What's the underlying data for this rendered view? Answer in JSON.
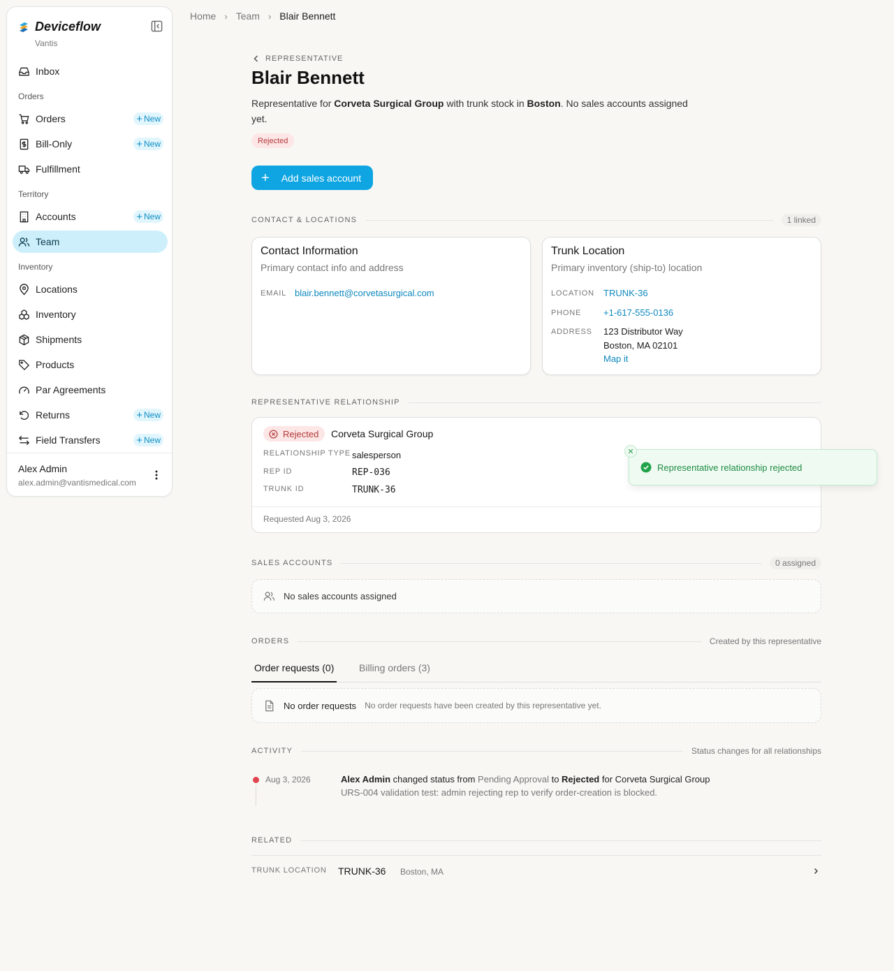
{
  "sidebar": {
    "brand": "Deviceflow",
    "org": "Vantis",
    "inbox": "Inbox",
    "sections": {
      "orders": "Orders",
      "territory": "Territory",
      "inventory": "Inventory"
    },
    "items": {
      "orders": "Orders",
      "bill_only": "Bill-Only",
      "fulfillment": "Fulfillment",
      "accounts": "Accounts",
      "team": "Team",
      "locations": "Locations",
      "inventory": "Inventory",
      "shipments": "Shipments",
      "products": "Products",
      "par_agreements": "Par Agreements",
      "returns": "Returns",
      "field_transfers": "Field Transfers"
    },
    "new_label": "New",
    "user": {
      "name": "Alex Admin",
      "email": "alex.admin@vantismedical.com"
    }
  },
  "breadcrumb": {
    "home": "Home",
    "team": "Team",
    "current": "Blair Bennett"
  },
  "header": {
    "back_label": "REPRESENTATIVE",
    "title": "Blair Bennett",
    "desc_prefix": "Representative for ",
    "desc_company": "Corveta Surgical Group",
    "desc_mid": " with trunk stock in ",
    "desc_city": "Boston",
    "desc_suffix": ". No sales accounts assigned yet.",
    "status": "Rejected",
    "add_button": "Add sales account"
  },
  "contact_section": {
    "label": "CONTACT & LOCATIONS",
    "meta": "1 linked",
    "contact_card": {
      "title": "Contact Information",
      "subtitle": "Primary contact info and address",
      "email_key": "EMAIL",
      "email": "blair.bennett@corvetasurgical.com"
    },
    "trunk_card": {
      "title": "Trunk Location",
      "subtitle": "Primary inventory (ship-to) location",
      "location_key": "LOCATION",
      "location": "TRUNK-36",
      "phone_key": "PHONE",
      "phone": "+1-617-555-0136",
      "address_key": "ADDRESS",
      "address_line1": "123 Distributor Way",
      "address_line2": "Boston, MA 02101",
      "map_link": "Map it"
    }
  },
  "relationship_section": {
    "label": "REPRESENTATIVE RELATIONSHIP",
    "status": "Rejected",
    "company": "Corveta Surgical Group",
    "type_key": "RELATIONSHIP TYPE",
    "type": "salesperson",
    "rep_id_key": "REP ID",
    "rep_id": "REP-036",
    "trunk_id_key": "TRUNK ID",
    "trunk_id": "TRUNK-36",
    "requested": "Requested Aug 3, 2026"
  },
  "sales_section": {
    "label": "SALES ACCOUNTS",
    "meta": "0 assigned",
    "empty": "No sales accounts assigned"
  },
  "orders_section": {
    "label": "ORDERS",
    "meta": "Created by this representative",
    "tabs": {
      "requests": "Order requests (0)",
      "billing": "Billing orders (3)"
    },
    "empty_title": "No order requests",
    "empty_desc": "No order requests have been created by this representative yet."
  },
  "activity_section": {
    "label": "ACTIVITY",
    "meta": "Status changes for all relationships",
    "entry": {
      "date": "Aug 3, 2026",
      "actor": "Alex Admin",
      "text1": " changed status from ",
      "from": "Pending Approval",
      "text2": " to ",
      "to": "Rejected",
      "text3": " for Corveta Surgical Group",
      "note": "URS-004 validation test: admin rejecting rep to verify order-creation is blocked."
    },
    "dot_color": "#e0454f"
  },
  "related_section": {
    "label": "RELATED",
    "key": "TRUNK LOCATION",
    "value": "TRUNK-36",
    "place": "Boston, MA"
  },
  "toast": {
    "message": "Representative relationship rejected"
  },
  "colors": {
    "accent": "#0ea5e2",
    "link": "#0e88bf",
    "rejected_bg": "#fde6e6",
    "rejected_text": "#b23a3a",
    "success": "#1f8a43"
  }
}
